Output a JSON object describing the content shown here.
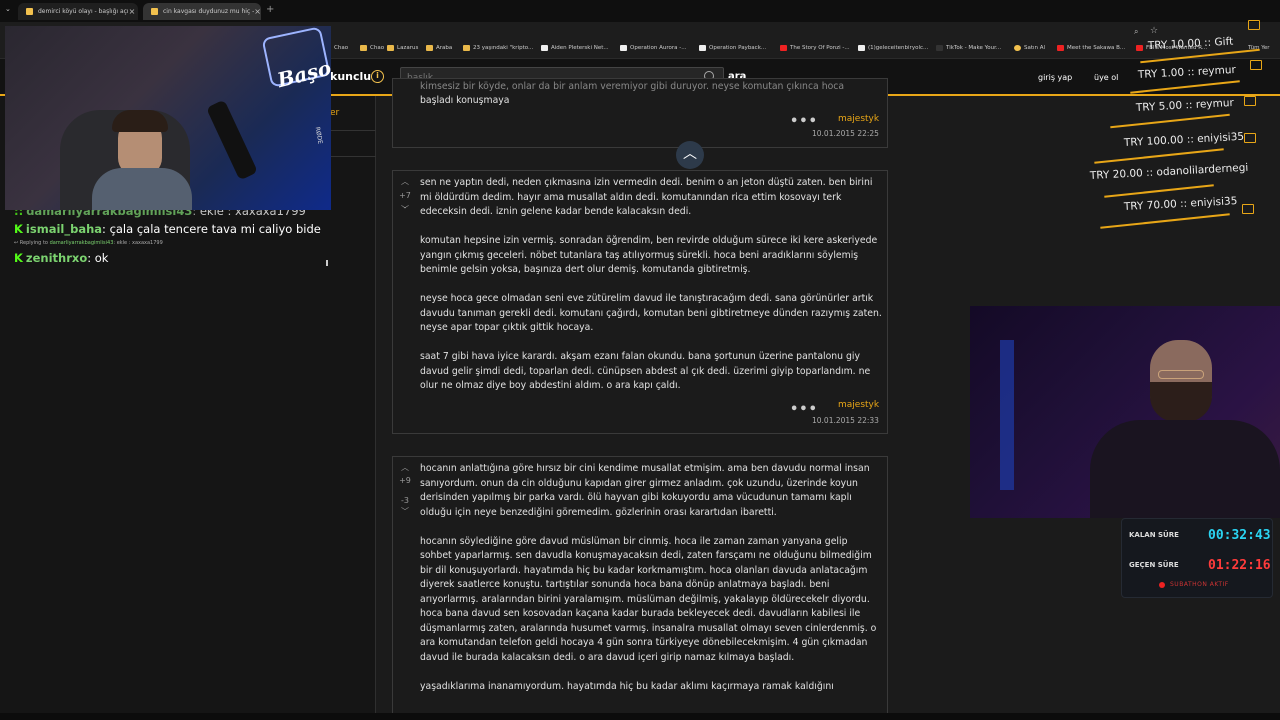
{
  "browser": {
    "tabs": [
      {
        "label": "demirci köyü olayı - başlığı açı"
      },
      {
        "label": "cin kavgası duydunuz mu hiç -"
      }
    ],
    "bookmarks": [
      "Chao",
      "Lazarus",
      "Araba",
      "23 yaşındaki \"kripto...",
      "Aiden Pleterski Net...",
      "Operation Aurora -...",
      "Operation Payback...",
      "The Story Of Ponzi -...",
      "(1)geleceitenbiryolc...",
      "TikTok - Make Your...",
      "Satın Al",
      "Meet the Sakawa B...",
      "FBI's Most Wanted R...",
      "Tüm Yer"
    ]
  },
  "site": {
    "logo": "kunclu",
    "search_placeholder": "başlık",
    "search_button": "ara",
    "nav": [
      "giriş yap",
      "üye ol"
    ],
    "left_fragment": "er"
  },
  "chat": [
    {
      "name": "damarliyarrakbagimlisi43",
      "text": "ekle : xaxaxa1799"
    },
    {
      "name": "ismail_baha",
      "text": "çala çala tencere tava mi caliyo bide"
    },
    {
      "reply_prefix": "Replying to",
      "reply_name": "damarliyarrakbagimlisi43",
      "reply_text": "ekle : xaxaxa1799"
    },
    {
      "name": "zenithrxo",
      "text": "ok"
    }
  ],
  "entries": [
    {
      "partial_top": "başladı konuşmaya",
      "partial_hidden": "kimsesiz bir köyde, onlar da bir anlam veremiyor gibi duruyor. neyse komutan çıkınca hoca",
      "author": "majestyk",
      "date": "10.01.2015 22:25"
    },
    {
      "votes_up": "+7",
      "votes_down": "-",
      "paragraphs": [
        "sen ne yaptın dedi, neden çıkmasına izin vermedin dedi. benim o an jeton düştü zaten. ben birini mi öldürdüm dedim. hayır ama musallat aldın dedi. komutanından rica ettim kosovayı terk edeceksin dedi. iznin gelene kadar bende kalacaksın dedi.",
        "komutan hepsine izin vermiş. sonradan öğrendim, ben revirde olduğum sürece iki kere askeriyede yangın çıkmış geceleri. nöbet tutanlara taş atılıyormuş sürekli. hoca beni aradıklarını söylemiş benimle gelsin yoksa, başınıza dert olur demiş. komutanda gibtiretmiş.",
        "neyse hoca gece olmadan seni eve zütürelim davud ile tanıştıracağım dedi. sana görünürler artık davudu tanıman gerekli dedi. komutanı çağırdı, komutan beni gibtiretmeye dünden razıymış zaten. neyse apar topar çıktık gittik hocaya.",
        "saat 7 gibi hava iyice karardı. akşam ezanı falan okundu. bana şortunun üzerine pantalonu giy davud gelir şimdi dedi, toparlan dedi. cünüpsen abdest al çık dedi. üzerimi giyip toparlandım. ne olur ne olmaz diye boy abdestini aldım. o ara kapı çaldı."
      ],
      "author": "majestyk",
      "date": "10.01.2015 22:33"
    },
    {
      "votes_up": "+9",
      "votes_down": "-3",
      "paragraphs": [
        "hocanın anlattığına göre hırsız bir cini kendime musallat etmişim. ama ben davudu normal insan sanıyordum. onun da cin olduğunu kapıdan girer girmez anladım. çok uzundu, üzerinde koyun derisinden yapılmış bir parka vardı. ölü hayvan gibi kokuyordu ama vücudunun tamamı kaplı olduğu için neye benzediğini göremedim. gözlerinin orası karartıdan ibaretti.",
        "hocanın söylediğine göre davud müslüman bir cinmiş. hoca ile zaman zaman yanyana gelip sohbet yaparlarmış. sen davudla konuşmayacaksın dedi, zaten farsçamı ne olduğunu bilmediğim bir dil konuşuyorlardı. hayatımda hiç bu kadar korkmamıştım. hoca olanları davuda anlatacağım diyerek saatlerce konuştu. tartıştılar sonunda hoca bana dönüp anlatmaya başladı. beni arıyorlarmış. aralarından birini yaralamışım. müslüman değilmiş, yakalayıp öldürecekelr diyordu. hoca bana davud sen kosovadan kaçana kadar burada bekleyecek dedi. davudların kabilesi ile düşmanlarmış zaten, aralarında husumet varmış. insanalra musallat olmayı seven cinlerdenmiş. o ara komutandan telefon geldi hocaya 4 gün sonra türkiyeye dönebilecekmişim. 4 gün çıkmadan davud ile burada kalacaksın dedi. o ara davud içeri girip namaz kılmaya başladı.",
        "yaşadıklarıma inanamıyordum. hayatımda hiç bu kadar aklımı kaçırmaya ramak kaldığını"
      ]
    }
  ],
  "overlay": {
    "cam_logo": "Başo",
    "mic_brand": "RØDE",
    "donations": [
      {
        "text": "TRY 10.00 :: Gift"
      },
      {
        "text": "TRY 1.00 :: reymur"
      },
      {
        "text": "TRY 5.00 :: reymur"
      },
      {
        "text": "TRY 100.00 :: eniyisi35"
      },
      {
        "text": "TRY 20.00 :: odanolilardernegi"
      },
      {
        "text": "TRY 70.00 :: eniyisi35"
      }
    ],
    "timer": {
      "remaining_label": "KALAN SÜRE",
      "remaining_value": "00:32:43",
      "elapsed_label": "GEÇEN SÜRE",
      "elapsed_value": "01:22:16",
      "status": "SUBATHON AKTIF"
    },
    "colors": {
      "accent": "#e8a617",
      "remaining": "#2ad4f2",
      "elapsed": "#ff3b3b",
      "kick_green": "#53fc18"
    }
  }
}
